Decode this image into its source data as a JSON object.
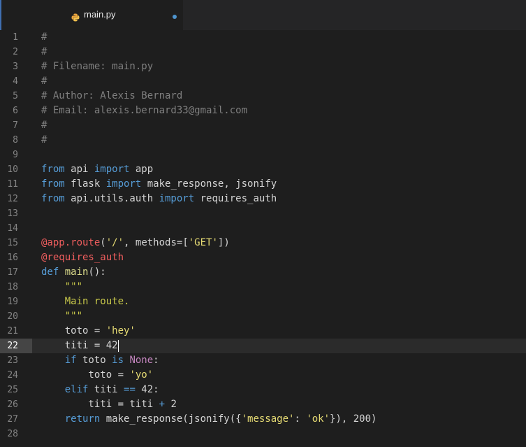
{
  "tab": {
    "filename": "main.py",
    "modified": true,
    "icon": "python-icon"
  },
  "editor": {
    "active_line": 22,
    "lines": [
      {
        "n": "1",
        "t": [
          [
            "c",
            "#"
          ]
        ]
      },
      {
        "n": "2",
        "t": [
          [
            "c",
            "#"
          ]
        ]
      },
      {
        "n": "3",
        "t": [
          [
            "c",
            "# Filename: main.py"
          ]
        ]
      },
      {
        "n": "4",
        "t": [
          [
            "c",
            "#"
          ]
        ]
      },
      {
        "n": "5",
        "t": [
          [
            "c",
            "# Author: Alexis Bernard"
          ]
        ]
      },
      {
        "n": "6",
        "t": [
          [
            "c",
            "# Email: alexis.bernard33@gmail.com"
          ]
        ]
      },
      {
        "n": "7",
        "t": [
          [
            "c",
            "#"
          ]
        ]
      },
      {
        "n": "8",
        "t": [
          [
            "c",
            "#"
          ]
        ]
      },
      {
        "n": "9",
        "t": []
      },
      {
        "n": "10",
        "t": [
          [
            "k",
            "from"
          ],
          [
            "p",
            " api "
          ],
          [
            "k",
            "import"
          ],
          [
            "p",
            " app"
          ]
        ]
      },
      {
        "n": "11",
        "t": [
          [
            "k",
            "from"
          ],
          [
            "p",
            " flask "
          ],
          [
            "k",
            "import"
          ],
          [
            "p",
            " make_response, jsonify"
          ]
        ]
      },
      {
        "n": "12",
        "t": [
          [
            "k",
            "from"
          ],
          [
            "p",
            " api.utils.auth "
          ],
          [
            "k",
            "import"
          ],
          [
            "p",
            " requires_auth"
          ]
        ]
      },
      {
        "n": "13",
        "t": []
      },
      {
        "n": "14",
        "t": []
      },
      {
        "n": "15",
        "t": [
          [
            "d",
            "@app.route"
          ],
          [
            "p",
            "("
          ],
          [
            "s",
            "'/'"
          ],
          [
            "p",
            ", methods=["
          ],
          [
            "s",
            "'GET'"
          ],
          [
            "p",
            "])"
          ]
        ]
      },
      {
        "n": "16",
        "t": [
          [
            "d",
            "@requires_auth"
          ]
        ]
      },
      {
        "n": "17",
        "t": [
          [
            "k",
            "def"
          ],
          [
            "p",
            " "
          ],
          [
            "f",
            "main"
          ],
          [
            "p",
            "():"
          ]
        ]
      },
      {
        "n": "18",
        "t": [
          [
            "p",
            "    "
          ],
          [
            "o",
            "\"\"\""
          ]
        ]
      },
      {
        "n": "19",
        "t": [
          [
            "p",
            "    "
          ],
          [
            "o",
            "Main route."
          ]
        ]
      },
      {
        "n": "20",
        "t": [
          [
            "p",
            "    "
          ],
          [
            "o",
            "\"\"\""
          ]
        ]
      },
      {
        "n": "21",
        "t": [
          [
            "p",
            "    toto = "
          ],
          [
            "s",
            "'hey'"
          ]
        ]
      },
      {
        "n": "22",
        "t": [
          [
            "p",
            "    titi = 42"
          ]
        ]
      },
      {
        "n": "23",
        "t": [
          [
            "p",
            "    "
          ],
          [
            "k",
            "if"
          ],
          [
            "p",
            " toto "
          ],
          [
            "k",
            "is"
          ],
          [
            "p",
            " "
          ],
          [
            "u",
            "None"
          ],
          [
            "p",
            ":"
          ]
        ]
      },
      {
        "n": "24",
        "t": [
          [
            "p",
            "        toto = "
          ],
          [
            "s",
            "'yo'"
          ]
        ]
      },
      {
        "n": "25",
        "t": [
          [
            "p",
            "    "
          ],
          [
            "k",
            "elif"
          ],
          [
            "p",
            " titi "
          ],
          [
            "k",
            "=="
          ],
          [
            "p",
            " 42:"
          ]
        ]
      },
      {
        "n": "26",
        "t": [
          [
            "p",
            "        titi = titi "
          ],
          [
            "k",
            "+"
          ],
          [
            "p",
            " 2"
          ]
        ]
      },
      {
        "n": "27",
        "t": [
          [
            "p",
            "    "
          ],
          [
            "k",
            "return"
          ],
          [
            "p",
            " make_response(jsonify({"
          ],
          [
            "s",
            "'message'"
          ],
          [
            "p",
            ": "
          ],
          [
            "s",
            "'ok'"
          ],
          [
            "p",
            "}), 200)"
          ]
        ]
      },
      {
        "n": "28",
        "t": []
      }
    ]
  },
  "colors": {
    "accent": "#4e94ce",
    "background": "#1e1e1e"
  }
}
